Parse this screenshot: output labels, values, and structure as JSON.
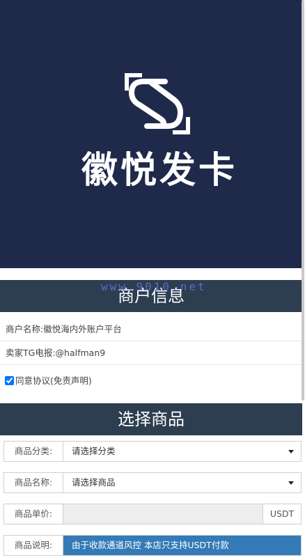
{
  "banner": {
    "brand_name": "徽悦发卡"
  },
  "watermark": {
    "text": "www.9010.net"
  },
  "merchant_section": {
    "title": "商户信息",
    "name_label": "商户名称:",
    "name_value": "徽悦海内外账户平台",
    "tg_label": "卖家TG电报:",
    "tg_value": "@halfman9",
    "agree_label": "同意协议(免责声明)",
    "agree_checked": true
  },
  "product_section": {
    "title": "选择商品",
    "category_label": "商品分类:",
    "category_value": "请选择分类",
    "product_label": "商品名称:",
    "product_value": "请选择商品",
    "price_label": "商品单价:",
    "price_value": "",
    "price_unit": "USDT",
    "desc_label": "商品说明:",
    "desc_value": "由于收款通道风控 本店只支持USDT付款"
  },
  "colors": {
    "banner_bg": "#1f2a4b",
    "section_header_bg": "#2c3e50",
    "notice_bg": "#337ab7"
  }
}
